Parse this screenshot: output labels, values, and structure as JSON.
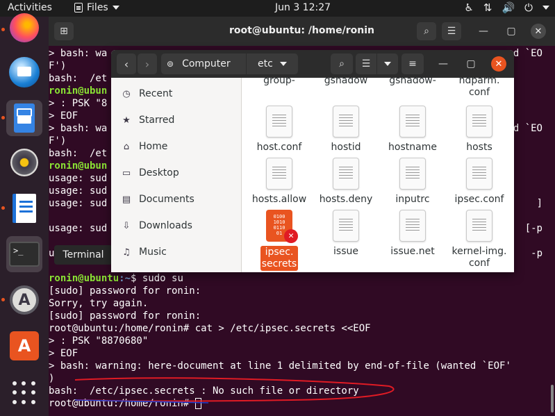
{
  "topbar": {
    "activities": "Activities",
    "app_menu": "Files",
    "clock": "Jun 3  12:27"
  },
  "dock": {
    "apps": [
      "firefox-icon",
      "thunderbird-icon",
      "files-icon",
      "rhythmbox-icon",
      "writer-icon",
      "terminal-icon",
      "software-icon",
      "app-center-icon",
      "show-apps-icon"
    ],
    "terminal_prompt_glyph": ">_",
    "software_glyph": "A",
    "store_glyph": "A"
  },
  "tooltip": "Terminal",
  "terminal": {
    "title": "root@ubuntu: /home/ronin",
    "lines": [
      "> bash: wa",
      "F')",
      "bash:  /et",
      "ronin@ubun",
      "> : PSK \"8",
      "> EOF",
      "> bash: wa",
      "F')",
      "bash:  /et",
      "ronin@ubun",
      "usage: sud",
      "usage: sud",
      "usage: sud",
      "",
      "usage: sud",
      "",
      "u"
    ],
    "right_fragments": [
      "d `EO",
      "d `EO",
      "]",
      "[-p",
      "-p"
    ],
    "lower_lines": {
      "prompt1_user": "ronin@ubuntu",
      "prompt1_path": ":~",
      "prompt1_cmd": "$ sudo su",
      "l2": "[sudo] password for ronin:",
      "l3": "Sorry, try again.",
      "l4": "[sudo] password for ronin:",
      "l5": "root@ubuntu:/home/ronin# cat > /etc/ipsec.secrets <<EOF",
      "l6": "> : PSK \"8870680\"",
      "l7": "> EOF",
      "l8": "> bash: warning: here-document at line 1 delimited by end-of-file (wanted `EOF'",
      "l9": ")",
      "l10": "bash:  /etc/ipsec.secrets : No such file or directory",
      "l11": "root@ubuntu:/home/ronin# "
    }
  },
  "filemanager": {
    "path": [
      "Computer",
      "etc"
    ],
    "sidebar": [
      "Recent",
      "Starred",
      "Home",
      "Desktop",
      "Documents",
      "Downloads",
      "Music"
    ],
    "sidebar_icons": [
      "clock-icon",
      "star-icon",
      "home-icon",
      "desktop-icon",
      "documents-icon",
      "downloads-icon",
      "music-icon"
    ],
    "top_partial_files": [
      "group-",
      "gshadow",
      "gshadow-",
      "hdparm.\nconf"
    ],
    "files": [
      "host.conf",
      "hostid",
      "hostname",
      "hosts",
      "hosts.allow",
      "hosts.deny",
      "inputrc",
      "ipsec.conf",
      "ipsec.\nsecrets",
      "issue",
      "issue.net",
      "kernel-img.\nconf"
    ],
    "selected": "ipsec.\nsecrets",
    "secret_binary": "0100\n1010\n0110\n01"
  }
}
